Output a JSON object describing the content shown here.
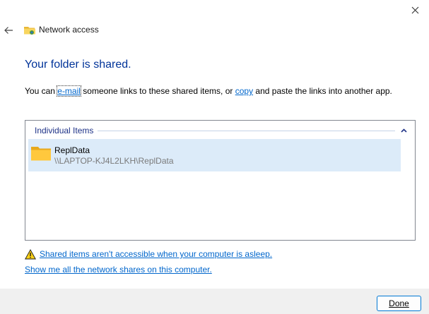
{
  "window": {
    "title": "Network access"
  },
  "heading": "Your folder is shared.",
  "description": {
    "prefix": "You can ",
    "email_link": "e-mail",
    "middle": " someone links to these shared items, or ",
    "copy_link": "copy",
    "suffix": " and paste the links into another app."
  },
  "list": {
    "group_label": "Individual Items",
    "items": [
      {
        "name": "ReplData",
        "path": "\\\\LAPTOP-KJ4L2LKH\\ReplData",
        "icon": "folder-icon",
        "selected": true
      }
    ]
  },
  "links": {
    "sleep_warning": "Shared items aren't accessible when your computer is asleep.",
    "show_shares": "Show me all the network shares on this computer."
  },
  "footer": {
    "done_label": "Done"
  },
  "colors": {
    "heading": "#003399",
    "link": "#0066cc",
    "selection": "#dcebf9",
    "footer": "#f0f0f0",
    "button_border": "#0078d4"
  }
}
